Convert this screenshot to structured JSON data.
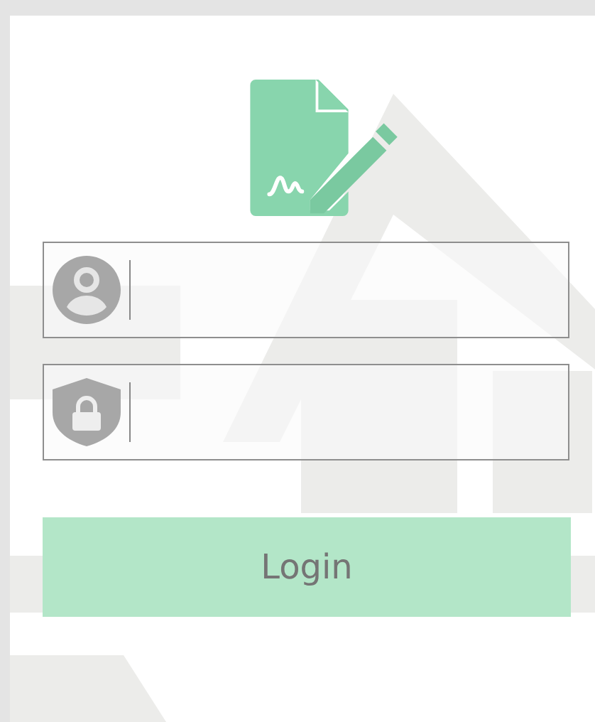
{
  "fields": [
    {
      "kind": "username"
    },
    {
      "kind": "password"
    }
  ],
  "login_button": {
    "label": "Login"
  }
}
